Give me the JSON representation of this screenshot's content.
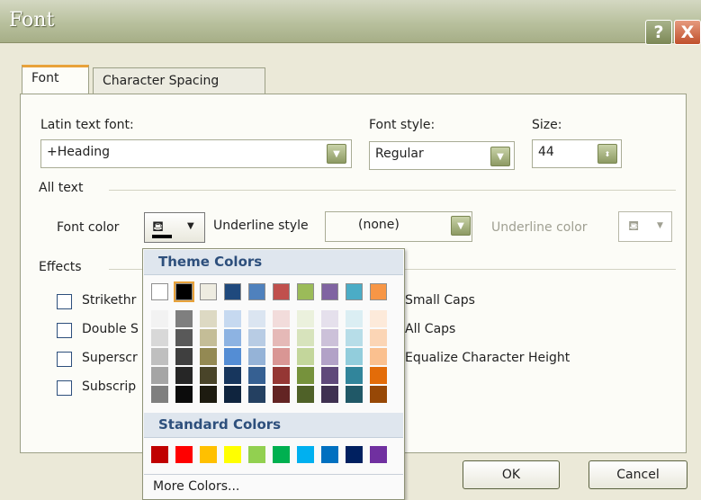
{
  "window": {
    "title": "Font",
    "help_label": "?",
    "close_label": "X"
  },
  "tabs": [
    {
      "label": "Font",
      "active": true
    },
    {
      "label": "Character Spacing",
      "active": false
    }
  ],
  "fields": {
    "latin_label": "Latin text font:",
    "latin_value": "+Heading",
    "style_label": "Font style:",
    "style_value": "Regular",
    "size_label": "Size:",
    "size_value": "44"
  },
  "all_text": {
    "section_label": "All text",
    "font_color_label": "Font color",
    "underline_style_label": "Underline style",
    "underline_style_value": "(none)",
    "underline_color_label": "Underline color"
  },
  "effects": {
    "section_label": "Effects",
    "left": [
      "Strikethr",
      "Double S",
      "Superscr",
      "Subscrip"
    ],
    "right": [
      "Small Caps",
      "All Caps",
      "Equalize Character Height"
    ]
  },
  "buttons": {
    "ok": "OK",
    "cancel": "Cancel"
  },
  "color_picker": {
    "theme_header": "Theme Colors",
    "standard_header": "Standard Colors",
    "more_colors": "More Colors...",
    "theme_colors": [
      "#ffffff",
      "#000000",
      "#eeece1",
      "#1f497d",
      "#4f81bd",
      "#c0504d",
      "#9bbb59",
      "#8064a2",
      "#4bacc6",
      "#f79646"
    ],
    "selected_index": 1,
    "tint_columns": [
      [
        "#f2f2f2",
        "#d8d8d8",
        "#bfbfbf",
        "#a5a5a5",
        "#7f7f7f"
      ],
      [
        "#7f7f7f",
        "#595959",
        "#3f3f3f",
        "#262626",
        "#0c0c0c"
      ],
      [
        "#ddd9c3",
        "#c4bd97",
        "#938953",
        "#494429",
        "#1d1b10"
      ],
      [
        "#c6d9f0",
        "#8db3e2",
        "#548dd4",
        "#17365d",
        "#0f243e"
      ],
      [
        "#dbe5f1",
        "#b8cce4",
        "#95b3d7",
        "#366092",
        "#244061"
      ],
      [
        "#f2dcdb",
        "#e5b9b7",
        "#d99694",
        "#953734",
        "#632423"
      ],
      [
        "#ebf1dd",
        "#d7e3bc",
        "#c3d69b",
        "#76923c",
        "#4f6128"
      ],
      [
        "#e5e0ec",
        "#ccc1d9",
        "#b2a2c7",
        "#5f497a",
        "#3f3151"
      ],
      [
        "#dbeef3",
        "#b7dde8",
        "#92cddc",
        "#31859b",
        "#205867"
      ],
      [
        "#fdeada",
        "#fbd5b5",
        "#fac08f",
        "#e36c09",
        "#974806"
      ]
    ],
    "standard_colors": [
      "#c00000",
      "#ff0000",
      "#ffc000",
      "#ffff00",
      "#92d050",
      "#00b050",
      "#00b0f0",
      "#0070c0",
      "#002060",
      "#7030a0"
    ]
  },
  "accent_colors": {
    "tab_highlight": "#e8a23a",
    "title_bar": "#b8c09d",
    "picker_header": "#2d4f7c"
  }
}
